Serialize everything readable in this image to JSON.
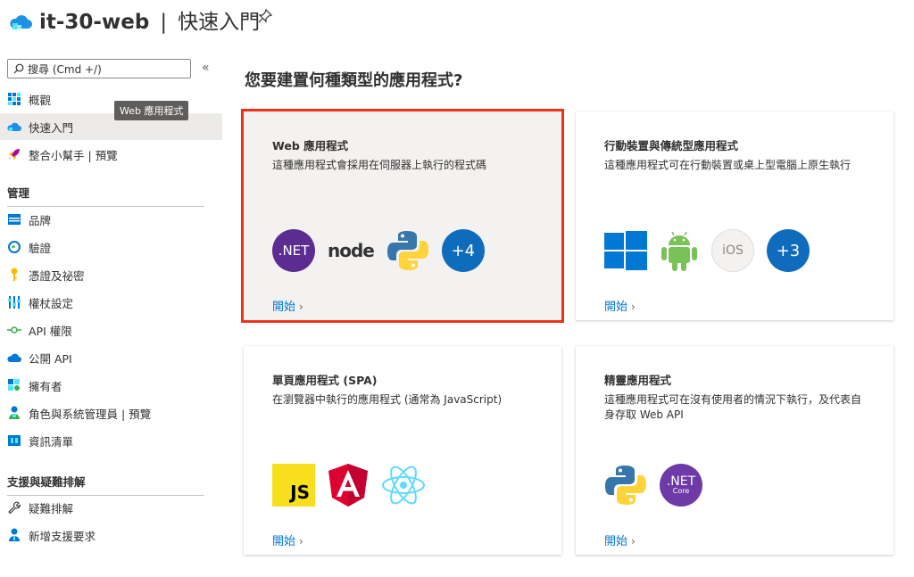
{
  "header": {
    "app_name": "it-30-web",
    "separator": "|",
    "page_name": "快速入門",
    "pin_icon": "pin-icon"
  },
  "sidebar": {
    "search_placeholder": "搜尋 (Cmd +/)",
    "collapse": "«",
    "tooltip": "Web 應用程式",
    "items_top": [
      {
        "label": "概觀",
        "icon": "grid-icon"
      },
      {
        "label": "快速入門",
        "icon": "cloud-icon",
        "active": true
      },
      {
        "label": "整合小幫手 | 預覽",
        "icon": "rocket-icon"
      }
    ],
    "section_manage": "管理",
    "items_manage": [
      {
        "label": "品牌",
        "icon": "branding-icon"
      },
      {
        "label": "驗證",
        "icon": "auth-icon"
      },
      {
        "label": "憑證及祕密",
        "icon": "key-icon"
      },
      {
        "label": "權杖設定",
        "icon": "token-icon"
      },
      {
        "label": "API 權限",
        "icon": "api-icon"
      },
      {
        "label": "公開 API",
        "icon": "cloud-api-icon"
      },
      {
        "label": "擁有者",
        "icon": "owner-icon"
      },
      {
        "label": "角色與系統管理員 | 預覽",
        "icon": "role-icon"
      },
      {
        "label": "資訊清單",
        "icon": "manifest-icon"
      }
    ],
    "section_support": "支援與疑難排解",
    "items_support": [
      {
        "label": "疑難排解",
        "icon": "wrench-icon"
      },
      {
        "label": "新增支援要求",
        "icon": "support-icon"
      }
    ]
  },
  "main": {
    "title": "您要建置何種類型的應用程式?",
    "cards": [
      {
        "title": "Web 應用程式",
        "desc": "這種應用程式會採用在伺服器上執行的程式碼",
        "link": "開始",
        "plus": "+4"
      },
      {
        "title": "行動裝置與傳統型應用程式",
        "desc": "這種應用程式可在行動裝置或桌上型電腦上原生執行",
        "link": "開始",
        "ios": "iOS",
        "plus": "+3"
      },
      {
        "title": "單頁應用程式 (SPA)",
        "desc": "在瀏覽器中執行的應用程式 (通常為 JavaScript)",
        "link": "開始",
        "js": "JS"
      },
      {
        "title": "精靈應用程式",
        "desc": "這種應用程式可在沒有使用者的情況下執行，及代表自身存取 Web API",
        "link": "開始",
        "net": ".NET",
        "core": "Core"
      }
    ],
    "dotnet_label": ".NET",
    "node_label": "node"
  },
  "colors": {
    "accent": "#0078d4",
    "selected_outline": "#f1301a"
  }
}
